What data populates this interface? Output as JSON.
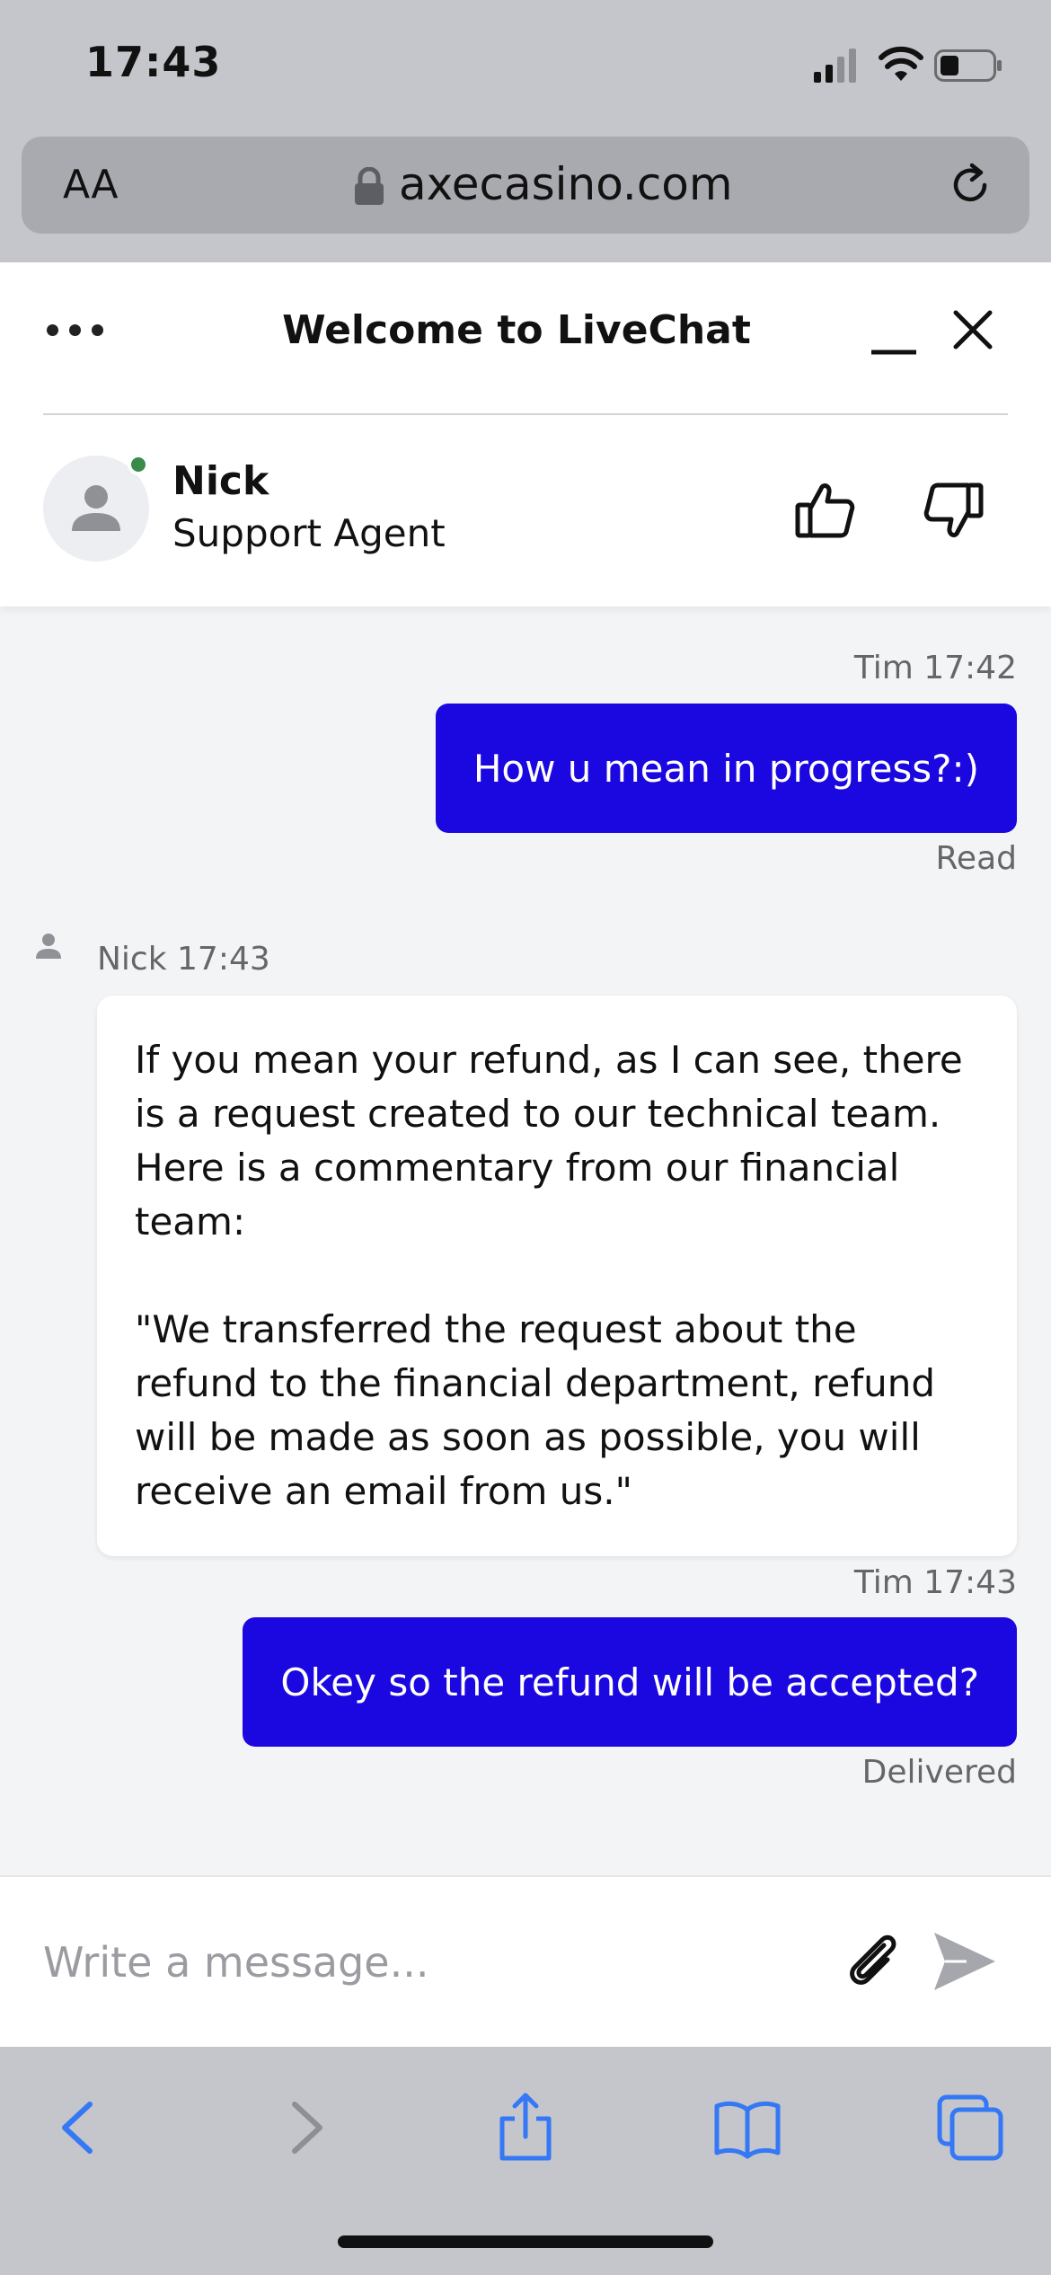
{
  "status_bar": {
    "time": "17:43"
  },
  "browser": {
    "text_size_label": "AA",
    "url": "axecasino.com"
  },
  "chat": {
    "title": "Welcome to LiveChat",
    "agent": {
      "name": "Nick",
      "role": "Support Agent",
      "status_color": "#3a8a4a"
    },
    "messages": [
      {
        "sender": "Tim",
        "time": "17:42",
        "meta": "Tim 17:42",
        "text": "How u mean in progress?:)",
        "status": "Read",
        "direction": "outgoing"
      },
      {
        "sender": "Nick",
        "time": "17:43",
        "meta": "Nick 17:43",
        "paragraphs": [
          "If you mean your refund, as I can see, there is a request created to our technical team. Here is a commentary from our financial team:",
          "\"We transferred the request about the refund to the financial department, refund will be made as soon as possible, you will receive an email from us.\""
        ],
        "direction": "incoming"
      },
      {
        "sender": "Tim",
        "time": "17:43",
        "meta": "Tim 17:43",
        "text": "Okey so the refund will be accepted?",
        "status": "Delivered",
        "direction": "outgoing"
      }
    ],
    "composer": {
      "placeholder": "Write a message..."
    },
    "colors": {
      "outgoing_bubble": "#1b07df",
      "toolbar_icon": "#3478f6"
    }
  },
  "icons": [
    "menu-dots-icon",
    "minimize-icon",
    "close-icon",
    "thumbs-up-icon",
    "thumbs-down-icon",
    "attach-icon",
    "send-icon",
    "back-icon",
    "forward-icon",
    "share-icon",
    "bookmarks-icon",
    "tabs-icon"
  ]
}
